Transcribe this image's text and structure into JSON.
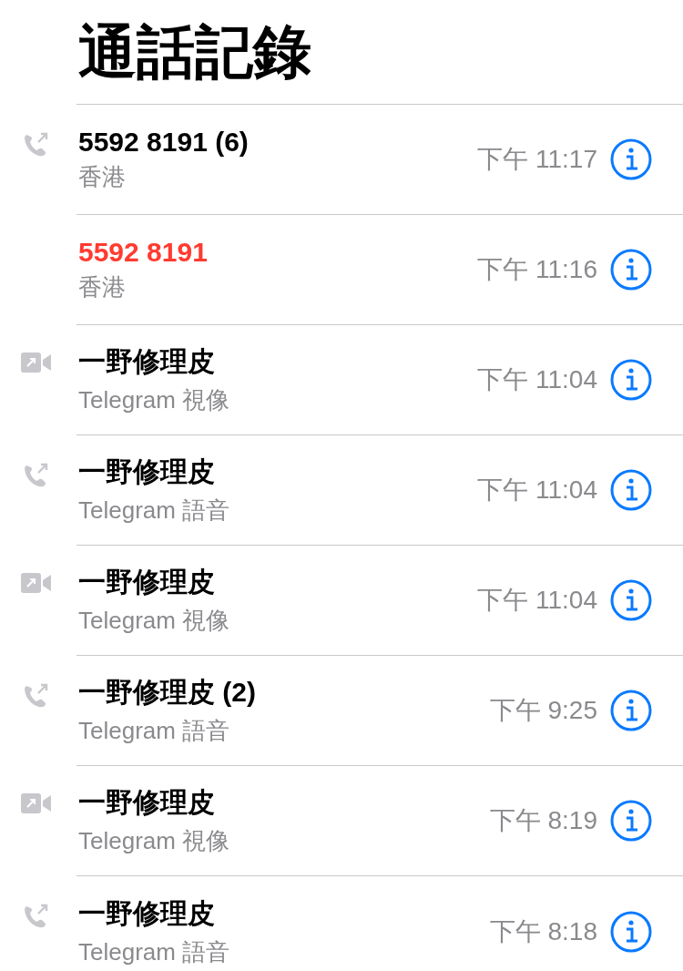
{
  "title": "通話記錄",
  "calls": [
    {
      "kind": "audio",
      "missed": false,
      "name": "5592 8191 (6)",
      "detail": "香港",
      "time": "下午 11:17"
    },
    {
      "kind": "none",
      "missed": true,
      "name": "5592 8191",
      "detail": "香港",
      "time": "下午 11:16"
    },
    {
      "kind": "video",
      "missed": false,
      "name": "一野修理皮",
      "detail": "Telegram 視像",
      "time": "下午 11:04"
    },
    {
      "kind": "audio",
      "missed": false,
      "name": "一野修理皮",
      "detail": "Telegram 語音",
      "time": "下午 11:04"
    },
    {
      "kind": "video",
      "missed": false,
      "name": "一野修理皮",
      "detail": "Telegram 視像",
      "time": "下午 11:04"
    },
    {
      "kind": "audio",
      "missed": false,
      "name": "一野修理皮 (2)",
      "detail": "Telegram 語音",
      "time": "下午 9:25"
    },
    {
      "kind": "video",
      "missed": false,
      "name": "一野修理皮",
      "detail": "Telegram 視像",
      "time": "下午 8:19"
    },
    {
      "kind": "audio",
      "missed": false,
      "name": "一野修理皮",
      "detail": "Telegram 語音",
      "time": "下午 8:18"
    }
  ]
}
